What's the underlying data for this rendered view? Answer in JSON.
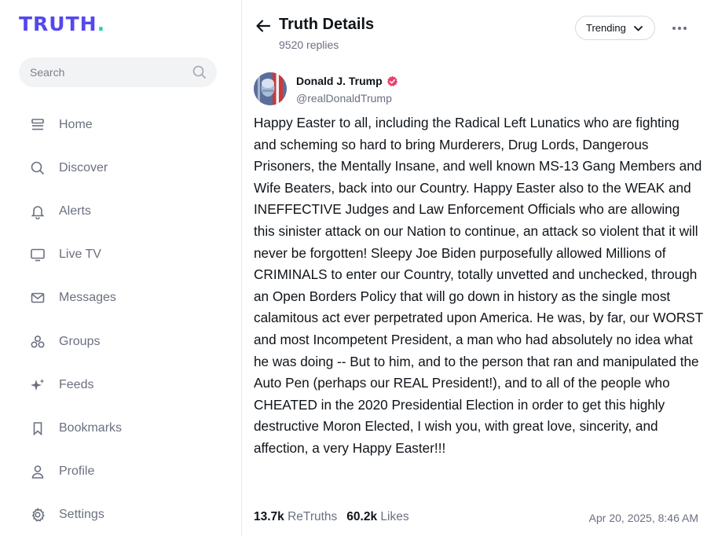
{
  "brand": {
    "logo_text": "TRUTH",
    "logo_dot": ".",
    "logo_color": "#5448ee",
    "dot_color": "#1fd1b2"
  },
  "search": {
    "placeholder": "Search",
    "value": ""
  },
  "sidebar": {
    "items": [
      {
        "label": "Home",
        "icon": "home-icon"
      },
      {
        "label": "Discover",
        "icon": "search-icon"
      },
      {
        "label": "Alerts",
        "icon": "bell-icon"
      },
      {
        "label": "Live TV",
        "icon": "tv-icon"
      },
      {
        "label": "Messages",
        "icon": "envelope-icon"
      },
      {
        "label": "Groups",
        "icon": "groups-icon"
      },
      {
        "label": "Feeds",
        "icon": "sparkle-icon"
      },
      {
        "label": "Bookmarks",
        "icon": "bookmark-icon"
      },
      {
        "label": "Profile",
        "icon": "person-icon"
      },
      {
        "label": "Settings",
        "icon": "gear-icon"
      }
    ]
  },
  "header": {
    "title": "Truth Details",
    "replies": "9520 replies",
    "sort_label": "Trending"
  },
  "post": {
    "author": "Donald J. Trump",
    "handle": "@realDonaldTrump",
    "verified_color": "#e8416b",
    "text": "Happy Easter to all, including the Radical Left Lunatics who are fighting and scheming so hard to bring Murderers, Drug Lords, Dangerous Prisoners, the Mentally Insane, and well known MS-13 Gang Members and Wife Beaters, back into our Country. Happy Easter also to the WEAK and INEFFECTIVE Judges and Law Enforcement Officials who are allowing this sinister attack on our Nation to continue, an attack so violent that it will never be forgotten! Sleepy Joe Biden purposefully allowed Millions of CRIMINALS to enter our Country, totally unvetted and unchecked, through an Open Borders Policy that will go down in history as the single most calamitous act ever perpetrated upon America. He was, by far, our WORST and most Incompetent President, a man who had absolutely no idea what he was doing -- But to him, and to the person that ran and manipulated the Auto Pen (perhaps our REAL President!), and to all of the people who CHEATED in the 2020 Presidential Election in order to get this highly destructive Moron Elected, I wish you, with great love, sincerity, and affection, a very Happy Easter!!!",
    "retruths_count": "13.7k",
    "retruths_label": "ReTruths",
    "likes_count": "60.2k",
    "likes_label": "Likes",
    "timestamp": "Apr 20, 2025, 8:46 AM"
  }
}
